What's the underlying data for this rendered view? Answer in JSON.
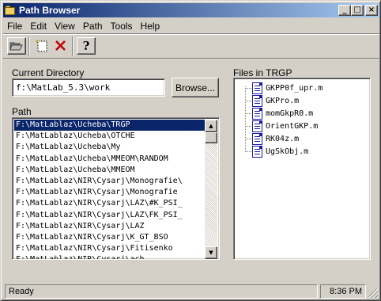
{
  "window": {
    "title": "Path Browser",
    "controls": {
      "minimize": "_",
      "maximize": "□",
      "close": "×"
    }
  },
  "menu": [
    "File",
    "Edit",
    "View",
    "Path",
    "Tools",
    "Help"
  ],
  "toolbar": {
    "buttons": [
      {
        "icon": "open-folder-icon"
      },
      {
        "icon": "new-file-icon"
      },
      {
        "icon": "delete-icon"
      },
      {
        "icon": "help-icon"
      }
    ]
  },
  "current_directory": {
    "label": "Current Directory",
    "value": "f:\\MatLab_5.3\\work",
    "browse_label": "Browse..."
  },
  "path": {
    "label": "Path",
    "items": [
      "F:\\MatLablaz\\Ucheba\\TRGP",
      "F:\\MatLablaz\\Ucheba\\OTCHE",
      "F:\\MatLablaz\\Ucheba\\My",
      "F:\\MatLablaz\\Ucheba\\MMEOM\\RANDOM",
      "F:\\MatLablaz\\Ucheba\\MMEOM",
      "F:\\MatLablaz\\NIR\\Cysarj\\Monografie\\",
      "F:\\MatLablaz\\NIR\\Cysarj\\Monografie",
      "F:\\MatLablaz\\NIR\\Cysarj\\LAZ\\#K_PSI_",
      "F:\\MatLablaz\\NIR\\Cysarj\\LAZ\\FK_PSI_",
      "F:\\MatLablaz\\NIR\\Cysarj\\LAZ",
      "F:\\MatLablaz\\NIR\\Cysarj\\K_GT_BSO",
      "F:\\MatLablaz\\NIR\\Cysarj\\Fitisenko",
      "F:\\MatLablaz\\NIR\\Cysarj\\ach"
    ],
    "selected_index": 0
  },
  "files": {
    "label": "Files in TRGP",
    "items": [
      "GKPP0f_upr.m",
      "GKPro.m",
      "momGkpR0.m",
      "OrientGKP.m",
      "RK04z.m",
      "UgSkObj.m"
    ]
  },
  "status": {
    "text": "Ready",
    "time": "8:36 PM"
  },
  "colors": {
    "titlebar_start": "#0a246a",
    "titlebar_end": "#a6caf0",
    "face": "#d4d0c8",
    "selection": "#0a246a"
  }
}
